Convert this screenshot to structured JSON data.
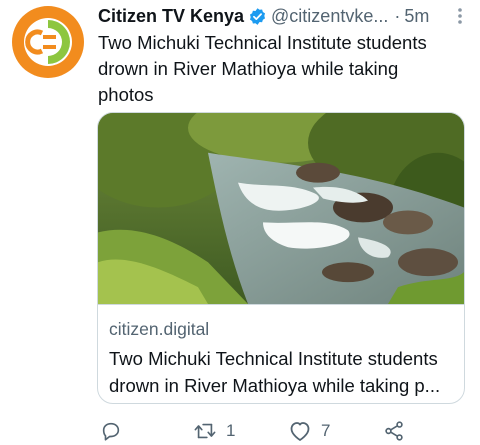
{
  "tweet": {
    "author_name": "Citizen TV Kenya",
    "handle": "@citizentvke...",
    "separator": "·",
    "time": "5m",
    "text_lines": [
      "Two Michuki Technical Institute students",
      "drown in River Mathioya while taking",
      "photos"
    ],
    "avatar_icon": "citizen-tv-logo-icon",
    "colors": {
      "logo_orange": "#f28c1e",
      "logo_green": "#8dc63f",
      "verified_blue": "#1d9bf0",
      "secondary_text": "#536471",
      "border": "#cfd9de"
    }
  },
  "card": {
    "image_icon": "river-rapids-photo",
    "domain": "citizen.digital",
    "title_lines": [
      "Two Michuki Technical Institute students",
      "drown in River Mathioya while taking p..."
    ]
  },
  "actions": {
    "reply_icon": "reply-icon",
    "retweet_icon": "retweet-icon",
    "retweet_count": "1",
    "like_icon": "heart-icon",
    "like_count": "7",
    "share_icon": "share-icon"
  }
}
